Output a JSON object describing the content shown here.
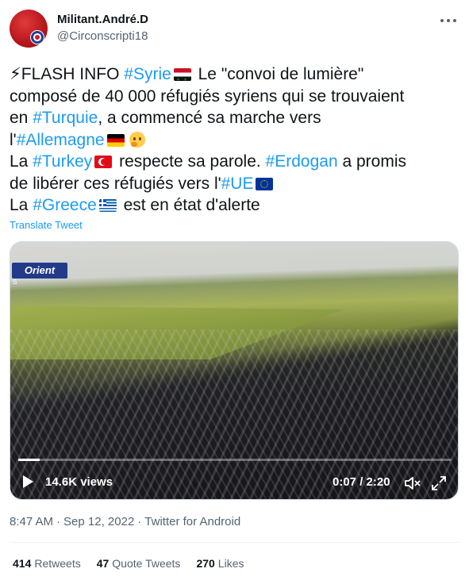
{
  "author": {
    "display_name": "Militant.André.D",
    "handle": "@Circonscripti18"
  },
  "tweet": {
    "lines": [
      [
        {
          "t": "⚡FLASH INFO "
        },
        {
          "t": "#Syrie",
          "tag": true
        },
        {
          "flag": "sy"
        },
        {
          "t": " Le \"convoi de lumière\""
        }
      ],
      [
        {
          "t": "composé de 40 000 réfugiés syriens qui se trouvaient"
        }
      ],
      [
        {
          "t": "en "
        },
        {
          "t": "#Turquie",
          "tag": true
        },
        {
          "t": ", a commencé sa marche vers"
        }
      ],
      [
        {
          "t": "l'"
        },
        {
          "t": "#Allemagne",
          "tag": true
        },
        {
          "flag": "de"
        },
        {
          "emoji": "thinking-face"
        }
      ],
      [
        {
          "t": "La "
        },
        {
          "t": "#Turkey",
          "tag": true
        },
        {
          "flag": "tr"
        },
        {
          "t": " respecte sa parole. "
        },
        {
          "t": "#Erdogan",
          "tag": true
        },
        {
          "t": " a promis"
        }
      ],
      [
        {
          "t": "de libérer ces réfugiés vers l'"
        },
        {
          "t": "#UE",
          "tag": true
        },
        {
          "flag": "eu"
        }
      ],
      [
        {
          "t": "La "
        },
        {
          "t": "#Greece",
          "tag": true
        },
        {
          "flag": "gr"
        },
        {
          "t": " est en état d'alerte"
        }
      ]
    ],
    "translate_label": "Translate Tweet"
  },
  "video": {
    "channel_logo": "Orient",
    "views": "14.6K views",
    "time": "0:07 / 2:20",
    "progress": 0.05
  },
  "meta": {
    "time": "8:47 AM",
    "date": "Sep 12, 2022",
    "source": "Twitter for Android"
  },
  "stats": {
    "retweets_count": "414",
    "retweets_label": "Retweets",
    "quotes_count": "47",
    "quotes_label": "Quote Tweets",
    "likes_count": "270",
    "likes_label": "Likes"
  }
}
